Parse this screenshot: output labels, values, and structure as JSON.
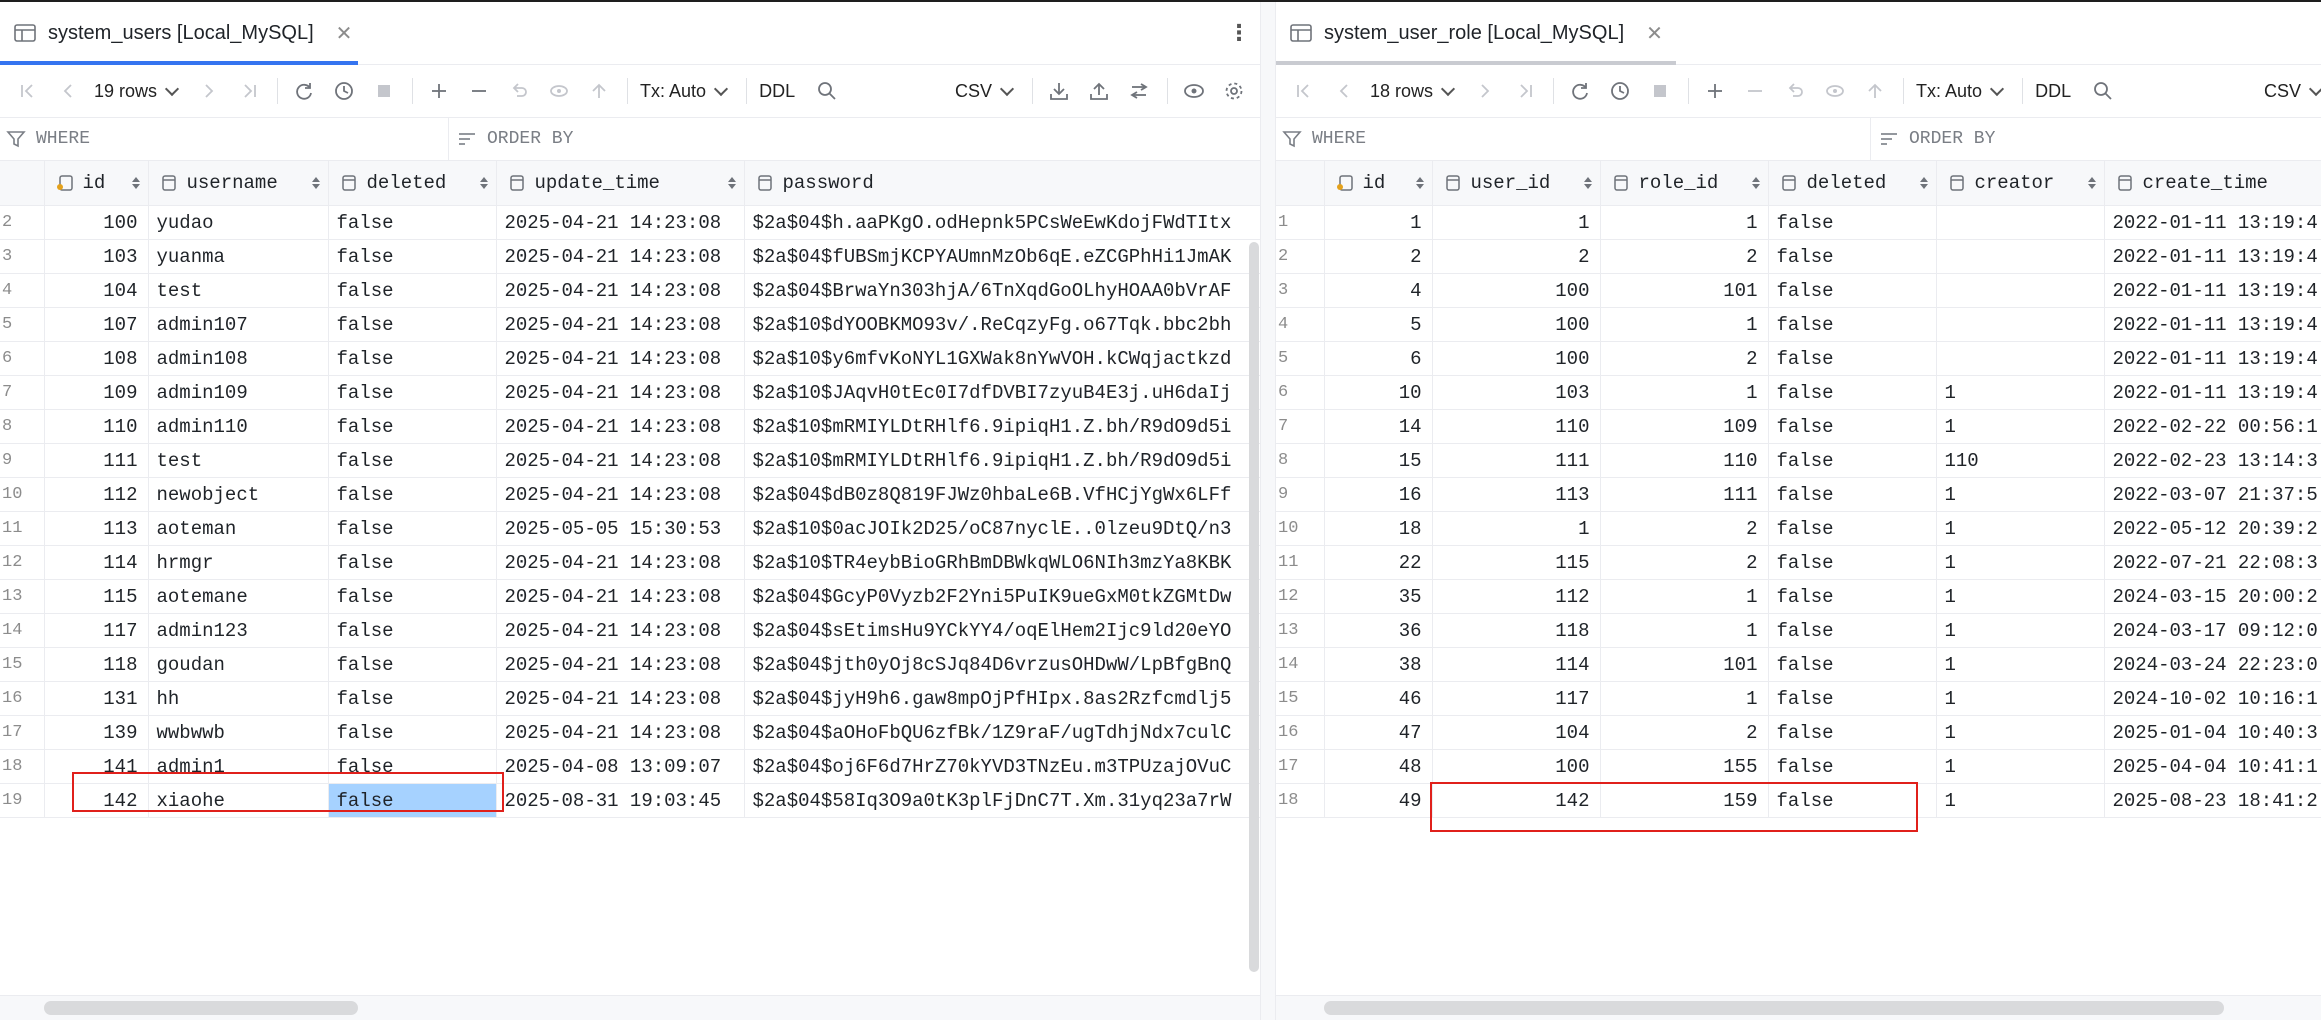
{
  "left": {
    "tab_title": "system_users [Local_MySQL]",
    "toolbar": {
      "rows_label": "19 rows",
      "tx_label": "Tx: Auto",
      "ddl_label": "DDL",
      "export_label": "CSV"
    },
    "filter": {
      "where": "WHERE",
      "order_by": "ORDER BY"
    },
    "columns": [
      "id",
      "username",
      "deleted",
      "update_time",
      "password"
    ],
    "rows": [
      [
        "2",
        "100",
        "yudao",
        "false",
        "2025-04-21 14:23:08",
        "$2a$04$h.aaPKgO.odHepnk5PCsWeEwKdojFWdTItx"
      ],
      [
        "3",
        "103",
        "yuanma",
        "false",
        "2025-04-21 14:23:08",
        "$2a$04$fUBSmjKCPYAUmnMzOb6qE.eZCGPhHi1JmAK"
      ],
      [
        "4",
        "104",
        "test",
        "false",
        "2025-04-21 14:23:08",
        "$2a$04$BrwaYn303hjA/6TnXqdGoOLhyHOAA0bVrAF"
      ],
      [
        "5",
        "107",
        "admin107",
        "false",
        "2025-04-21 14:23:08",
        "$2a$10$dYOOBKMO93v/.ReCqzyFg.o67Tqk.bbc2bh"
      ],
      [
        "6",
        "108",
        "admin108",
        "false",
        "2025-04-21 14:23:08",
        "$2a$10$y6mfvKoNYL1GXWak8nYwVOH.kCWqjactkzd"
      ],
      [
        "7",
        "109",
        "admin109",
        "false",
        "2025-04-21 14:23:08",
        "$2a$10$JAqvH0tEc0I7dfDVBI7zyuB4E3j.uH6daIj"
      ],
      [
        "8",
        "110",
        "admin110",
        "false",
        "2025-04-21 14:23:08",
        "$2a$10$mRMIYLDtRHlf6.9ipiqH1.Z.bh/R9dO9d5i"
      ],
      [
        "9",
        "111",
        "test",
        "false",
        "2025-04-21 14:23:08",
        "$2a$10$mRMIYLDtRHlf6.9ipiqH1.Z.bh/R9dO9d5i"
      ],
      [
        "10",
        "112",
        "newobject",
        "false",
        "2025-04-21 14:23:08",
        "$2a$04$dB0z8Q819FJWz0hbaLe6B.VfHCjYgWx6LFf"
      ],
      [
        "11",
        "113",
        "aoteman",
        "false",
        "2025-05-05 15:30:53",
        "$2a$10$0acJOIk2D25/oC87nyclE..0lzeu9DtQ/n3"
      ],
      [
        "12",
        "114",
        "hrmgr",
        "false",
        "2025-04-21 14:23:08",
        "$2a$10$TR4eybBioGRhBmDBWkqWLO6NIh3mzYa8KBK"
      ],
      [
        "13",
        "115",
        "aotemane",
        "false",
        "2025-04-21 14:23:08",
        "$2a$04$GcyP0Vyzb2F2Yni5PuIK9ueGxM0tkZGMtDw"
      ],
      [
        "14",
        "117",
        "admin123",
        "false",
        "2025-04-21 14:23:08",
        "$2a$04$sEtimsHu9YCkYY4/oqElHem2Ijc9ld20eYO"
      ],
      [
        "15",
        "118",
        "goudan",
        "false",
        "2025-04-21 14:23:08",
        "$2a$04$jth0yOj8cSJq84D6vrzusOHDwW/LpBfgBnQ"
      ],
      [
        "16",
        "131",
        "hh",
        "false",
        "2025-04-21 14:23:08",
        "$2a$04$jyH9h6.gaw8mpOjPfHIpx.8as2Rzfcmdlj5"
      ],
      [
        "17",
        "139",
        "wwbwwb",
        "false",
        "2025-04-21 14:23:08",
        "$2a$04$aOHoFbQU6zfBk/1Z9raF/ugTdhjNdx7culC"
      ],
      [
        "18",
        "141",
        "admin1",
        "false",
        "2025-04-08 13:09:07",
        "$2a$04$oj6F6d7HrZ70kYVD3TNzEu.m3TPUzajOVuC"
      ],
      [
        "19",
        "142",
        "xiaohe",
        "false",
        "2025-08-31 19:03:45",
        "$2a$04$58Iq3O9a0tK3plFjDnC7T.Xm.31yq23a7rW"
      ]
    ]
  },
  "right": {
    "tab_title": "system_user_role [Local_MySQL]",
    "toolbar": {
      "rows_label": "18 rows",
      "tx_label": "Tx: Auto",
      "ddl_label": "DDL",
      "export_label": "CSV"
    },
    "filter": {
      "where": "WHERE",
      "order_by": "ORDER BY"
    },
    "columns": [
      "id",
      "user_id",
      "role_id",
      "deleted",
      "creator",
      "create_time"
    ],
    "rows": [
      [
        "1",
        "1",
        "1",
        "1",
        "false",
        "",
        "2022-01-11 13:19:4"
      ],
      [
        "2",
        "2",
        "2",
        "2",
        "false",
        "",
        "2022-01-11 13:19:4"
      ],
      [
        "3",
        "4",
        "100",
        "101",
        "false",
        "",
        "2022-01-11 13:19:4"
      ],
      [
        "4",
        "5",
        "100",
        "1",
        "false",
        "",
        "2022-01-11 13:19:4"
      ],
      [
        "5",
        "6",
        "100",
        "2",
        "false",
        "",
        "2022-01-11 13:19:4"
      ],
      [
        "6",
        "10",
        "103",
        "1",
        "false",
        "1",
        "2022-01-11 13:19:4"
      ],
      [
        "7",
        "14",
        "110",
        "109",
        "false",
        "1",
        "2022-02-22 00:56:1"
      ],
      [
        "8",
        "15",
        "111",
        "110",
        "false",
        "110",
        "2022-02-23 13:14:3"
      ],
      [
        "9",
        "16",
        "113",
        "111",
        "false",
        "1",
        "2022-03-07 21:37:5"
      ],
      [
        "10",
        "18",
        "1",
        "2",
        "false",
        "1",
        "2022-05-12 20:39:2"
      ],
      [
        "11",
        "22",
        "115",
        "2",
        "false",
        "1",
        "2022-07-21 22:08:3"
      ],
      [
        "12",
        "35",
        "112",
        "1",
        "false",
        "1",
        "2024-03-15 20:00:2"
      ],
      [
        "13",
        "36",
        "118",
        "1",
        "false",
        "1",
        "2024-03-17 09:12:0"
      ],
      [
        "14",
        "38",
        "114",
        "101",
        "false",
        "1",
        "2024-03-24 22:23:0"
      ],
      [
        "15",
        "46",
        "117",
        "1",
        "false",
        "1",
        "2024-10-02 10:16:1"
      ],
      [
        "16",
        "47",
        "104",
        "2",
        "false",
        "1",
        "2025-01-04 10:40:3"
      ],
      [
        "17",
        "48",
        "100",
        "155",
        "false",
        "1",
        "2025-04-04 10:41:1"
      ],
      [
        "18",
        "49",
        "142",
        "159",
        "false",
        "1",
        "2025-08-23 18:41:2"
      ]
    ]
  },
  "colors": {
    "accent": "#3574f0",
    "selection": "#a6d2ff",
    "highlight": "#e0201b"
  }
}
